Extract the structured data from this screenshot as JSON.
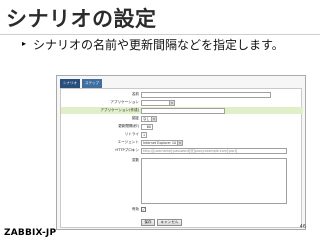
{
  "slide": {
    "title": "シナリオの設定",
    "bullet_marker": "▸",
    "bullet": "シナリオの名前や更新間隔などを指定します。",
    "logo": "ZABBIX-JP",
    "page_number": "46"
  },
  "screenshot": {
    "tabs": [
      {
        "label": "シナリオ",
        "active": true
      },
      {
        "label": "ステップ",
        "active": false
      }
    ],
    "fields": {
      "name": {
        "label": "名前",
        "value": ""
      },
      "application": {
        "label": "アプリケーション",
        "value": ""
      },
      "new_application": {
        "label": "アプリケーション(作成)",
        "value": ""
      },
      "auth": {
        "label": "認証",
        "value": "なし"
      },
      "interval": {
        "label": "更新間隔(秒)",
        "value": "60"
      },
      "retries": {
        "label": "リトライ",
        "value": "1"
      },
      "agent": {
        "label": "エージェント",
        "value": "Internet Explorer 10 (Wi"
      },
      "proxy": {
        "label": "HTTPプロキシ",
        "value": "http://[username[:password]@]proxy.example.com[:port]"
      },
      "variables": {
        "label": "変数",
        "value": ""
      },
      "enabled": {
        "label": "有効",
        "checked": true
      }
    },
    "buttons": {
      "save": "保存",
      "cancel": "キャンセル"
    },
    "select_arrow": "▾",
    "checkmark": "✓"
  }
}
